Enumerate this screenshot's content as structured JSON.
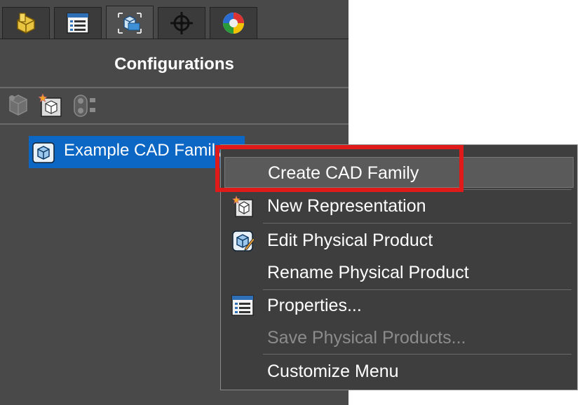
{
  "panel": {
    "title": "Configurations",
    "tabs": [
      {
        "icon": "part-icon"
      },
      {
        "icon": "list-icon"
      },
      {
        "icon": "configurations-icon",
        "active": true
      },
      {
        "icon": "crosshair-icon"
      },
      {
        "icon": "appearance-icon"
      }
    ],
    "toolbar": [
      "configuration-tool-icon",
      "new-representation-icon",
      "toggle-icon"
    ]
  },
  "tree": {
    "item_label": "Example CAD Family",
    "item_icon": "cad-family-icon"
  },
  "context_menu": {
    "items": [
      {
        "label": "Create CAD Family",
        "state": "highlighted"
      },
      {
        "label": "New Representation",
        "icon": "new-representation-icon"
      },
      {
        "label": "Edit Physical Product",
        "icon": "edit-physical-product-icon"
      },
      {
        "label": "Rename Physical Product"
      },
      {
        "label": "Properties...",
        "icon": "properties-icon"
      },
      {
        "label": "Save Physical Products...",
        "state": "disabled"
      },
      {
        "label": "Customize Menu"
      }
    ]
  },
  "colors": {
    "panel_bg": "#494949",
    "selection": "#0b66c4",
    "annotation_box": "#e01919",
    "menu_bg": "#3e3e3e"
  }
}
